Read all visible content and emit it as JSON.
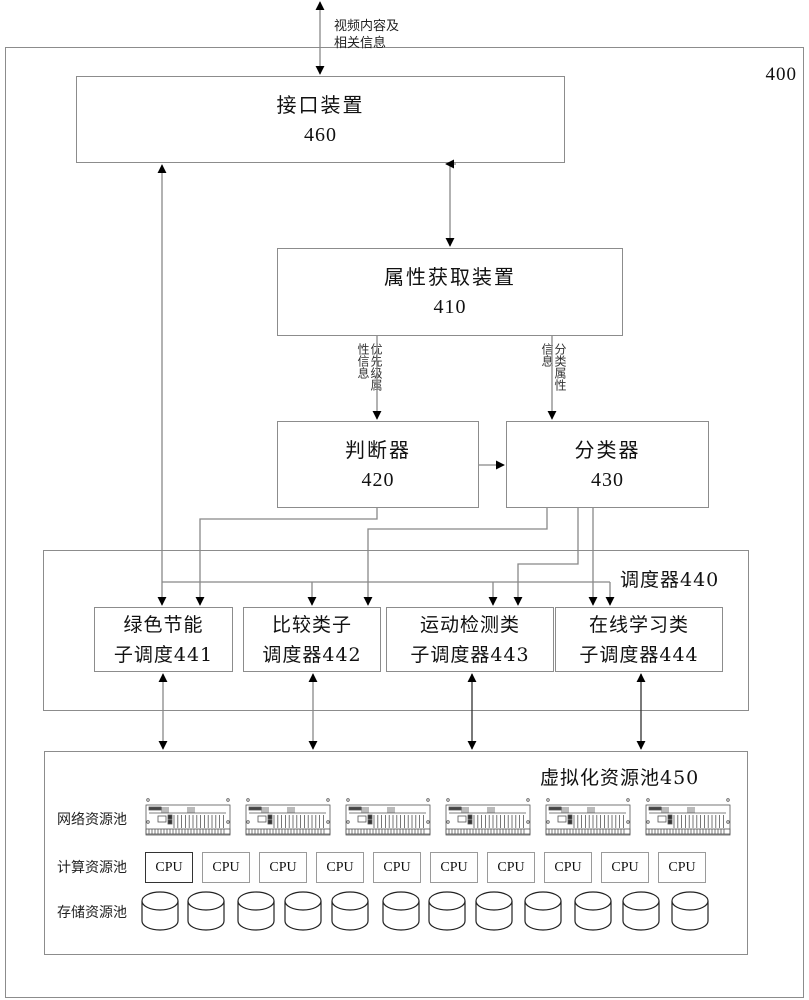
{
  "system": {
    "label": "400"
  },
  "external_io": {
    "line1": "视频内容及",
    "line2": "相关信息"
  },
  "interface": {
    "title": "接口装置",
    "number": "460"
  },
  "attribute": {
    "title": "属性获取装置",
    "number": "410"
  },
  "priority_info_label": "优先级属性信息",
  "class_info_label": "分类属性信息",
  "judge": {
    "title": "判断器",
    "number": "420"
  },
  "classifier": {
    "title": "分类器",
    "number": "430"
  },
  "scheduler": {
    "label": "调度器440",
    "subs": [
      {
        "line1": "绿色节能",
        "line2": "子调度441"
      },
      {
        "line1": "比较类子",
        "line2": "调度器442"
      },
      {
        "line1": "运动检测类",
        "line2": "子调度器443"
      },
      {
        "line1": "在线学习类",
        "line2": "子调度器444"
      }
    ]
  },
  "pool": {
    "label": "虚拟化资源池450",
    "network_label": "网络资源池",
    "compute_label": "计算资源池",
    "storage_label": "存储资源池",
    "network_device_count": 6,
    "cpu_label": "CPU",
    "cpu_count": 10,
    "storage_count": 12
  }
}
